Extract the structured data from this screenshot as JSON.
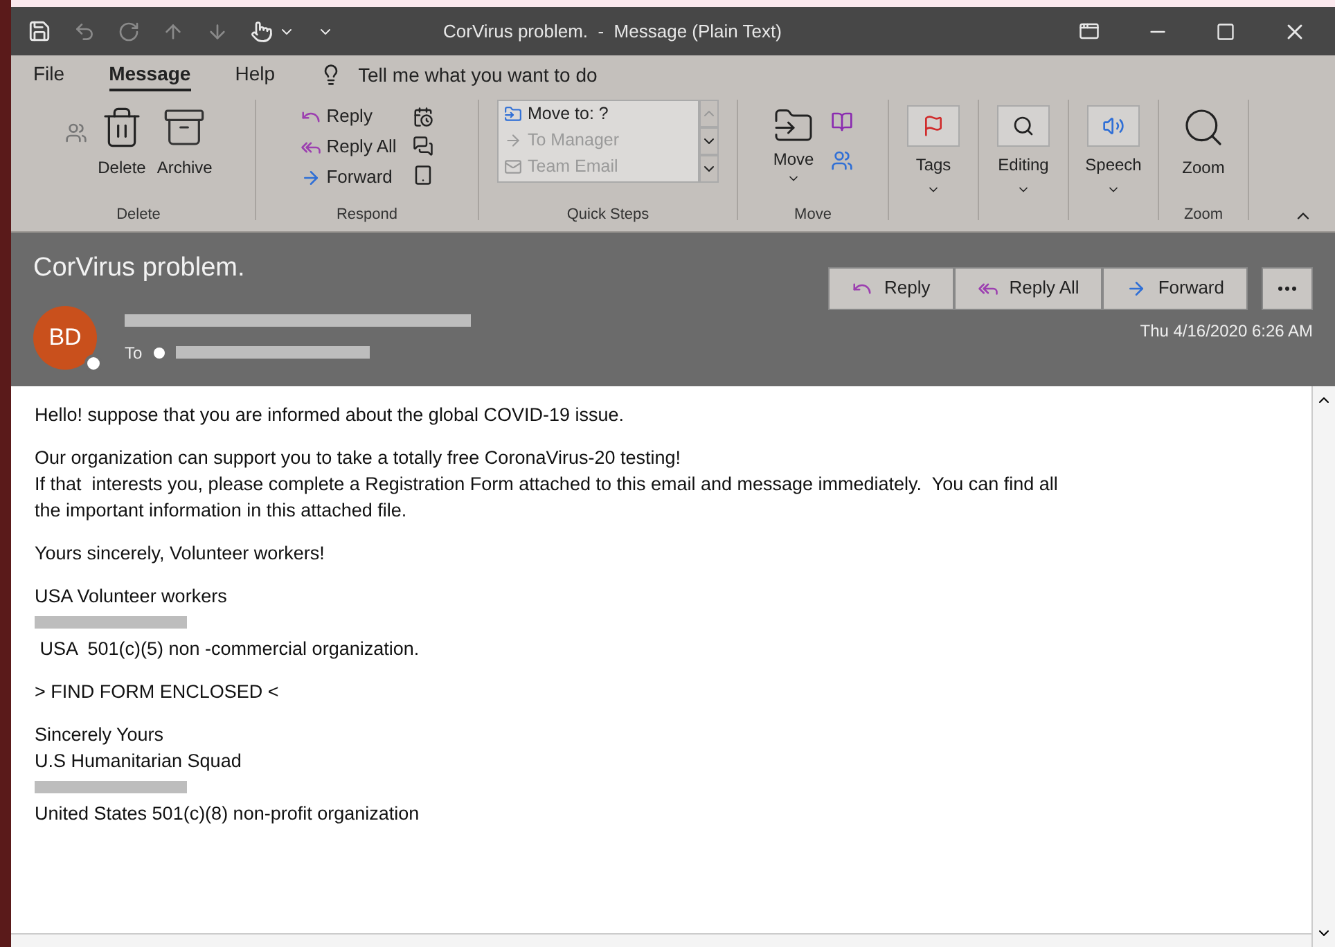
{
  "title_bar": {
    "title": "CorVirus problem.  -  Message (Plain Text)"
  },
  "menu_tabs": [
    {
      "label": "File",
      "selected": false
    },
    {
      "label": "Message",
      "selected": true
    },
    {
      "label": "Help",
      "selected": false
    }
  ],
  "tell_me": {
    "placeholder": "Tell me what you want to do"
  },
  "ribbon": {
    "delete_group": {
      "label": "Delete",
      "buttons": [
        "Delete",
        "Archive"
      ]
    },
    "respond_group": {
      "label": "Respond",
      "buttons": [
        "Reply",
        "Reply All",
        "Forward"
      ]
    },
    "quick_steps_group": {
      "label": "Quick Steps",
      "items": [
        {
          "label": "Move to: ?",
          "disabled": false
        },
        {
          "label": "To Manager",
          "disabled": true
        },
        {
          "label": "Team Email",
          "disabled": true
        }
      ]
    },
    "move_group": {
      "label": "Move",
      "button": "Move"
    },
    "tags": {
      "button": "Tags"
    },
    "editing": {
      "button": "Editing"
    },
    "speech": {
      "button": "Speech"
    },
    "zoom_group": {
      "label": "Zoom",
      "button": "Zoom"
    }
  },
  "header": {
    "subject": "CorVirus problem.",
    "avatar_initials": "BD",
    "to_label": "To",
    "actions": [
      "Reply",
      "Reply All",
      "Forward"
    ],
    "date": "Thu 4/16/2020 6:26 AM"
  },
  "body": [
    [
      {
        "kind": "text",
        "text": "Hello! suppose that you are informed about the global COVID-19 issue."
      }
    ],
    [
      {
        "kind": "text",
        "text": "Our organization can support you to take a totally free CoronaVirus-20 testing!"
      },
      {
        "kind": "text",
        "text": "If that  interests you, please complete a Registration Form attached to this email and message immediately.  You can find all"
      },
      {
        "kind": "text",
        "text": "the important information in this attached file."
      }
    ],
    [
      {
        "kind": "text",
        "text": "Yours sincerely, Volunteer workers!"
      }
    ],
    [
      {
        "kind": "text",
        "text": "USA Volunteer workers"
      },
      {
        "kind": "redacted"
      },
      {
        "kind": "text",
        "text": " USA  501(c)(5) non -commercial organization."
      }
    ],
    [
      {
        "kind": "text",
        "text": "> FIND FORM ENCLOSED <"
      }
    ],
    [
      {
        "kind": "text",
        "text": "Sincerely Yours"
      },
      {
        "kind": "text",
        "text": "U.S Humanitarian Squad"
      },
      {
        "kind": "redacted"
      },
      {
        "kind": "text",
        "text": "United States 501(c)(8) non-profit organization"
      }
    ]
  ]
}
